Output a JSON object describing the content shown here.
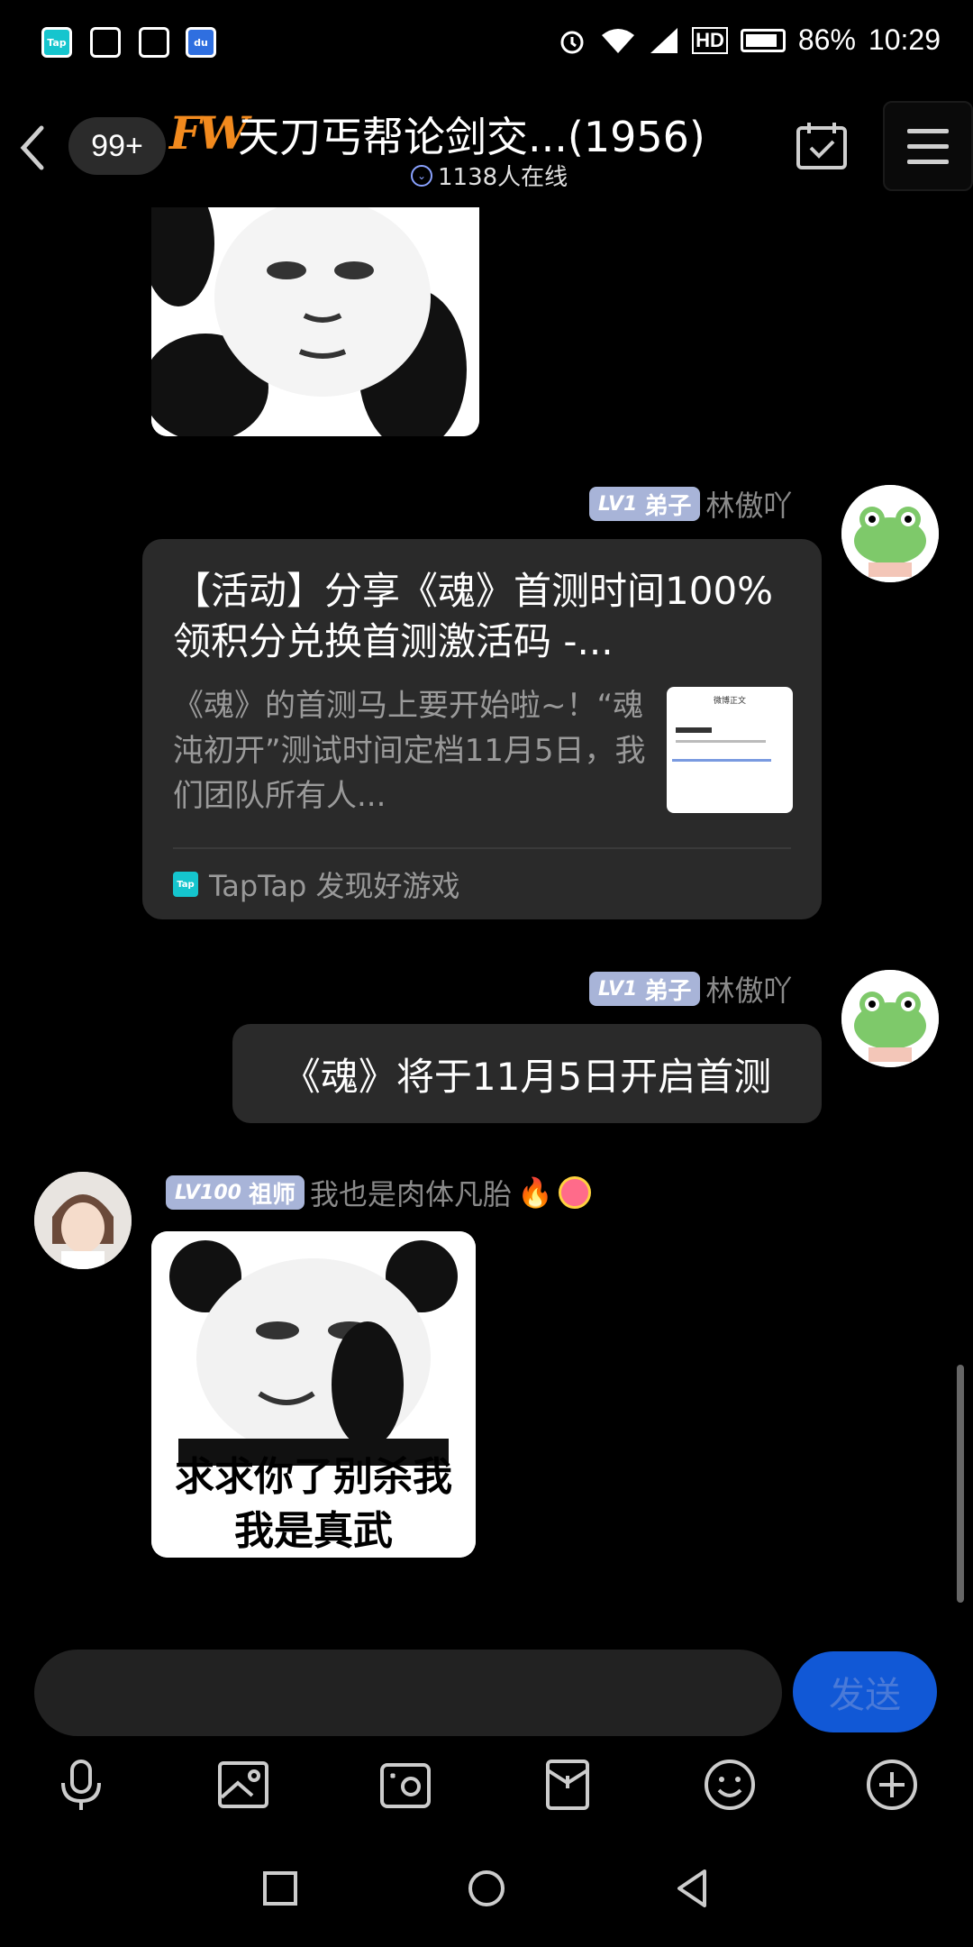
{
  "status_bar": {
    "apps": [
      "Tap",
      "",
      "",
      "du"
    ],
    "battery": "86%",
    "time": "10:29"
  },
  "header": {
    "badge": "99+",
    "logo": "FW",
    "title": "天刀丐帮论剑交...(1956)",
    "online": "1138人在线"
  },
  "messages": [
    {
      "sender_level": "LV1",
      "sender_rank": "弟子",
      "sender_name": "林傲吖",
      "link_card": {
        "title": "【活动】分享《魂》首测时间100%领积分兑换首测激活码 -...",
        "description": "《魂》的首测马上要开始啦~！“魂沌初开”测试时间定档11月5日，我们团队所有人...",
        "thumb_title": "微博正文",
        "source_logo": "Tap",
        "source": "TapTap 发现好游戏"
      }
    },
    {
      "sender_level": "LV1",
      "sender_rank": "弟子",
      "sender_name": "林傲吖",
      "text": "《魂》将于11月5日开启首测"
    },
    {
      "sender_level": "LV100",
      "sender_rank": "祖师",
      "sender_name": "我也是肉体凡胎",
      "sticker_caption_1": "求求你了别杀我",
      "sticker_caption_2": "我是真武"
    }
  ],
  "input": {
    "placeholder": "",
    "send_label": "发送"
  },
  "toolbar": [
    "microphone-icon",
    "image-icon",
    "camera-icon",
    "red-packet-icon",
    "emoji-icon",
    "plus-icon"
  ],
  "colors": {
    "background": "#000000",
    "bubble": "#2a2a2a",
    "send_button": "#1158d6",
    "level_pill": "#a8b4d8",
    "logo": "#f28a1e"
  }
}
